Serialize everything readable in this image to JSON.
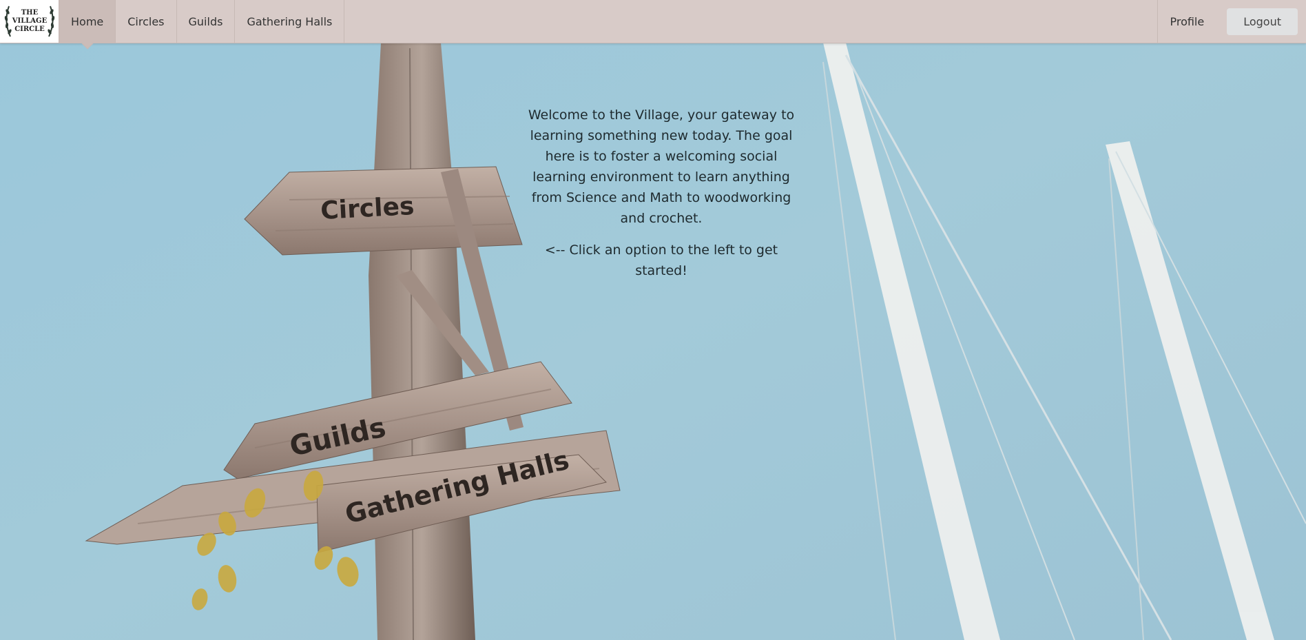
{
  "logo": {
    "line1": "THE",
    "line2": "VILLAGE",
    "line3": "CIRCLE"
  },
  "nav": {
    "items": [
      {
        "label": "Home",
        "active": true
      },
      {
        "label": "Circles",
        "active": false
      },
      {
        "label": "Guilds",
        "active": false
      },
      {
        "label": "Gathering Halls",
        "active": false
      }
    ],
    "profile": "Profile",
    "logout": "Logout"
  },
  "welcome": {
    "intro": "Welcome to the Village, your gateway to learning something new today. The goal here is to foster a welcoming social learning environment to learn anything from Science and Math to woodworking and crochet.",
    "prompt": "<-- Click an option to the left to get started!"
  },
  "signs": {
    "circles": "Circles",
    "guilds": "Guilds",
    "halls": "Gathering Halls"
  },
  "colors": {
    "nav_bg": "#d8cbc8",
    "sky": "#9cc6d8",
    "wood": "#b5a298"
  }
}
